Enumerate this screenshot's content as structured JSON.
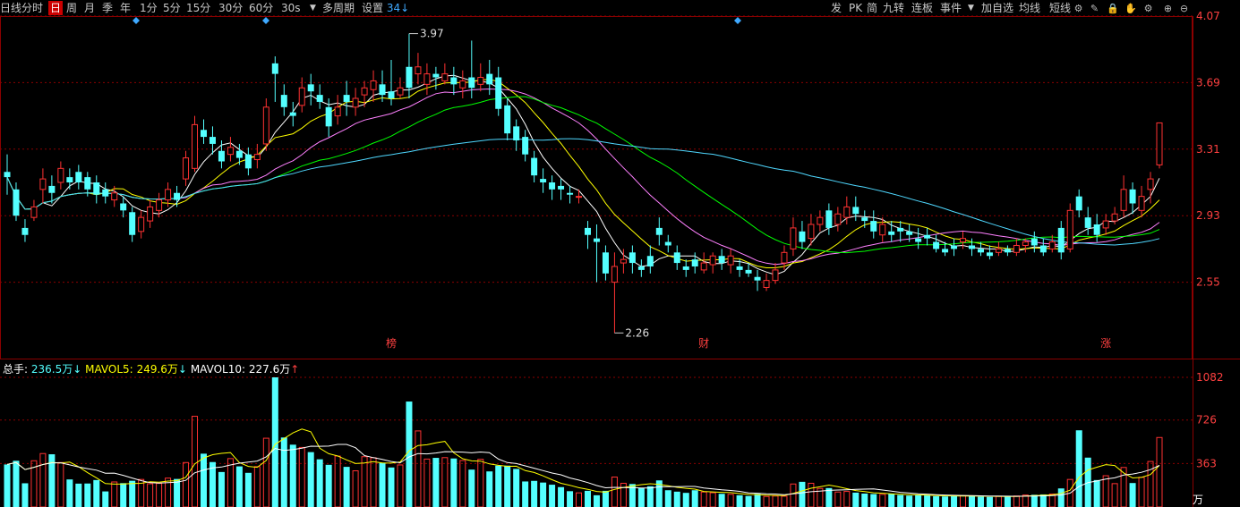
{
  "toolbar": {
    "left_items": [
      {
        "label": "日线",
        "active": false
      },
      {
        "label": "分时",
        "active": false
      },
      {
        "label": "日",
        "active": true
      },
      {
        "label": "周",
        "active": false
      },
      {
        "label": "月",
        "active": false
      },
      {
        "label": "季",
        "active": false
      },
      {
        "label": "年",
        "active": false
      },
      {
        "label": "1分",
        "active": false
      },
      {
        "label": "5分",
        "active": false
      },
      {
        "label": "15分",
        "active": false
      },
      {
        "label": "30分",
        "active": false
      },
      {
        "label": "60分",
        "active": false
      },
      {
        "label": "30s",
        "active": false
      },
      {
        "label": "多周期",
        "active": false
      }
    ],
    "settings_label": "设置",
    "settings_value": "34",
    "right_items": [
      "发",
      "PK",
      "简",
      "九转",
      "连板",
      "事件",
      "加自选",
      "均线",
      "短线"
    ],
    "icons": [
      "tool-icon",
      "pen-icon",
      "lock-icon",
      "hand-icon",
      "gear-icon",
      "zoom-in-icon",
      "zoom-out-icon"
    ]
  },
  "colors": {
    "up": "#ff3232",
    "down": "#54ffff",
    "ma5": "#ffffff",
    "ma10": "#ffff00",
    "ma20": "#ff80ff",
    "ma30": "#00ff00",
    "ma60": "#4fd8ff",
    "grid": "#8b0000",
    "axis_text": "#ff4040",
    "vol_ma5": "#ffff00",
    "vol_ma10": "#ffffff"
  },
  "chart_data": {
    "type": "candlestick",
    "price_axis": {
      "ticks": [
        "4.07",
        "3.69",
        "3.31",
        "2.93",
        "2.55"
      ],
      "ylim": [
        2.17,
        4.07
      ]
    },
    "volume_axis": {
      "ticks": [
        "1082",
        "726",
        "363"
      ],
      "unit": "万",
      "ylim": [
        0,
        1082
      ]
    },
    "annotations": {
      "high": "3.97",
      "low": "2.26"
    },
    "markers": [
      {
        "label": "榜",
        "index": 43
      },
      {
        "label": "财",
        "index": 78
      },
      {
        "label": "涨",
        "index": 123
      }
    ],
    "volume_legend": {
      "total_label": "总手:",
      "total_value": "236.5万",
      "total_arrow": "↓",
      "ma5_label": "MAVOL5:",
      "ma5_value": "249.6万",
      "ma5_arrow": "↓",
      "ma10_label": "MAVOL10:",
      "ma10_value": "227.6万",
      "ma10_arrow": "↑"
    },
    "candles": [
      [
        3.18,
        3.15,
        3.28,
        3.05,
        355
      ],
      [
        3.08,
        2.93,
        3.12,
        2.9,
        386
      ],
      [
        2.86,
        2.82,
        2.91,
        2.78,
        198
      ],
      [
        2.92,
        2.98,
        3.02,
        2.9,
        386
      ],
      [
        3.08,
        3.14,
        3.2,
        3.0,
        446
      ],
      [
        3.1,
        3.06,
        3.16,
        3.0,
        440
      ],
      [
        3.12,
        3.2,
        3.24,
        3.08,
        371
      ],
      [
        3.15,
        3.12,
        3.2,
        3.08,
        230
      ],
      [
        3.18,
        3.12,
        3.22,
        3.08,
        195
      ],
      [
        3.15,
        3.08,
        3.18,
        3.04,
        196
      ],
      [
        3.12,
        3.05,
        3.16,
        3.0,
        225
      ],
      [
        3.08,
        3.04,
        3.12,
        3.0,
        130
      ],
      [
        3.02,
        3.06,
        3.1,
        2.98,
        209
      ],
      [
        3.0,
        2.96,
        3.04,
        2.92,
        199
      ],
      [
        2.95,
        2.82,
        2.98,
        2.78,
        219
      ],
      [
        2.84,
        2.92,
        2.96,
        2.8,
        230
      ],
      [
        2.9,
        2.98,
        3.02,
        2.86,
        194
      ],
      [
        2.96,
        3.02,
        3.06,
        2.92,
        197
      ],
      [
        3.02,
        3.08,
        3.12,
        2.98,
        241
      ],
      [
        3.06,
        3.02,
        3.1,
        2.98,
        234
      ],
      [
        3.14,
        3.26,
        3.3,
        3.1,
        371
      ],
      [
        3.2,
        3.45,
        3.5,
        3.18,
        757
      ],
      [
        3.42,
        3.38,
        3.48,
        3.34,
        445
      ],
      [
        3.38,
        3.34,
        3.44,
        3.28,
        375
      ],
      [
        3.3,
        3.24,
        3.36,
        3.2,
        292
      ],
      [
        3.28,
        3.32,
        3.38,
        3.24,
        404
      ],
      [
        3.3,
        3.26,
        3.34,
        3.22,
        339
      ],
      [
        3.28,
        3.2,
        3.32,
        3.16,
        285
      ],
      [
        3.25,
        3.28,
        3.34,
        3.2,
        337
      ],
      [
        3.34,
        3.55,
        3.6,
        3.3,
        574
      ],
      [
        3.8,
        3.74,
        3.84,
        3.58,
        1082
      ],
      [
        3.62,
        3.55,
        3.68,
        3.5,
        580
      ],
      [
        3.52,
        3.5,
        3.58,
        3.44,
        520
      ],
      [
        3.56,
        3.66,
        3.72,
        3.52,
        497
      ],
      [
        3.68,
        3.64,
        3.74,
        3.56,
        458
      ],
      [
        3.62,
        3.58,
        3.68,
        3.54,
        398
      ],
      [
        3.55,
        3.44,
        3.6,
        3.38,
        352
      ],
      [
        3.5,
        3.55,
        3.62,
        3.45,
        425
      ],
      [
        3.62,
        3.58,
        3.7,
        3.5,
        335
      ],
      [
        3.55,
        3.6,
        3.66,
        3.5,
        302
      ],
      [
        3.62,
        3.66,
        3.7,
        3.55,
        420
      ],
      [
        3.65,
        3.7,
        3.76,
        3.58,
        411
      ],
      [
        3.68,
        3.62,
        3.76,
        3.58,
        370
      ],
      [
        3.64,
        3.6,
        3.82,
        3.56,
        330
      ],
      [
        3.62,
        3.66,
        3.72,
        3.6,
        351
      ],
      [
        3.78,
        3.66,
        3.97,
        3.6,
        880
      ],
      [
        3.74,
        3.78,
        3.86,
        3.68,
        635
      ],
      [
        3.68,
        3.74,
        3.8,
        3.62,
        400
      ],
      [
        3.74,
        3.72,
        3.78,
        3.65,
        410
      ],
      [
        3.7,
        3.74,
        3.8,
        3.68,
        412
      ],
      [
        3.72,
        3.68,
        3.78,
        3.62,
        405
      ],
      [
        3.66,
        3.7,
        3.76,
        3.6,
        388
      ],
      [
        3.72,
        3.66,
        3.93,
        3.6,
        312
      ],
      [
        3.68,
        3.72,
        3.8,
        3.64,
        398
      ],
      [
        3.74,
        3.68,
        3.82,
        3.62,
        297
      ],
      [
        3.72,
        3.54,
        3.78,
        3.5,
        345
      ],
      [
        3.56,
        3.4,
        3.6,
        3.36,
        345
      ],
      [
        3.44,
        3.36,
        3.48,
        3.3,
        318
      ],
      [
        3.38,
        3.28,
        3.42,
        3.24,
        213
      ],
      [
        3.26,
        3.16,
        3.3,
        3.12,
        218
      ],
      [
        3.14,
        3.12,
        3.2,
        3.06,
        204
      ],
      [
        3.12,
        3.08,
        3.16,
        3.02,
        186
      ],
      [
        3.1,
        3.08,
        3.14,
        3.02,
        166
      ],
      [
        3.06,
        3.05,
        3.1,
        3.0,
        132
      ],
      [
        3.04,
        3.04,
        3.08,
        3.0,
        118
      ],
      [
        2.86,
        2.82,
        2.9,
        2.74,
        135
      ],
      [
        2.8,
        2.78,
        2.88,
        2.55,
        98
      ],
      [
        2.72,
        2.6,
        2.76,
        2.56,
        135
      ],
      [
        2.55,
        2.64,
        2.72,
        2.26,
        250
      ],
      [
        2.66,
        2.68,
        2.74,
        2.6,
        198
      ],
      [
        2.72,
        2.66,
        2.76,
        2.6,
        192
      ],
      [
        2.64,
        2.62,
        2.68,
        2.58,
        157
      ],
      [
        2.7,
        2.64,
        2.76,
        2.6,
        173
      ],
      [
        2.86,
        2.82,
        2.92,
        2.76,
        222
      ],
      [
        2.78,
        2.76,
        2.82,
        2.72,
        140
      ],
      [
        2.72,
        2.66,
        2.76,
        2.62,
        128
      ],
      [
        2.64,
        2.62,
        2.68,
        2.58,
        118
      ],
      [
        2.68,
        2.64,
        2.72,
        2.6,
        140
      ],
      [
        2.62,
        2.66,
        2.72,
        2.6,
        125
      ],
      [
        2.65,
        2.7,
        2.72,
        2.6,
        119
      ],
      [
        2.7,
        2.66,
        2.74,
        2.62,
        110
      ],
      [
        2.65,
        2.7,
        2.74,
        2.6,
        106
      ],
      [
        2.64,
        2.62,
        2.68,
        2.58,
        98
      ],
      [
        2.62,
        2.6,
        2.66,
        2.58,
        92
      ],
      [
        2.58,
        2.56,
        2.62,
        2.5,
        110
      ],
      [
        2.52,
        2.56,
        2.6,
        2.5,
        88
      ],
      [
        2.56,
        2.62,
        2.66,
        2.54,
        92
      ],
      [
        2.66,
        2.72,
        2.76,
        2.62,
        90
      ],
      [
        2.74,
        2.86,
        2.92,
        2.7,
        192
      ],
      [
        2.84,
        2.78,
        2.9,
        2.74,
        210
      ],
      [
        2.8,
        2.88,
        2.94,
        2.76,
        198
      ],
      [
        2.88,
        2.92,
        2.96,
        2.84,
        155
      ],
      [
        2.96,
        2.86,
        3.0,
        2.82,
        158
      ],
      [
        2.88,
        2.94,
        2.98,
        2.84,
        125
      ],
      [
        2.92,
        2.98,
        3.04,
        2.88,
        130
      ],
      [
        2.98,
        2.94,
        3.04,
        2.9,
        120
      ],
      [
        2.92,
        2.9,
        2.96,
        2.86,
        112
      ],
      [
        2.9,
        2.84,
        2.96,
        2.8,
        108
      ],
      [
        2.82,
        2.88,
        2.92,
        2.78,
        105
      ],
      [
        2.84,
        2.82,
        2.9,
        2.78,
        108
      ],
      [
        2.86,
        2.84,
        2.9,
        2.78,
        100
      ],
      [
        2.84,
        2.82,
        2.88,
        2.78,
        95
      ],
      [
        2.8,
        2.78,
        2.86,
        2.74,
        98
      ],
      [
        2.82,
        2.8,
        2.86,
        2.76,
        97
      ],
      [
        2.78,
        2.74,
        2.82,
        2.72,
        90
      ],
      [
        2.74,
        2.72,
        2.78,
        2.7,
        88
      ],
      [
        2.76,
        2.74,
        2.8,
        2.7,
        90
      ],
      [
        2.78,
        2.8,
        2.84,
        2.74,
        95
      ],
      [
        2.76,
        2.74,
        2.8,
        2.7,
        92
      ],
      [
        2.74,
        2.72,
        2.78,
        2.7,
        86
      ],
      [
        2.72,
        2.7,
        2.76,
        2.68,
        84
      ],
      [
        2.72,
        2.74,
        2.78,
        2.7,
        88
      ],
      [
        2.74,
        2.72,
        2.76,
        2.7,
        90
      ],
      [
        2.72,
        2.76,
        2.8,
        2.7,
        92
      ],
      [
        2.76,
        2.78,
        2.8,
        2.72,
        100
      ],
      [
        2.8,
        2.76,
        2.84,
        2.72,
        102
      ],
      [
        2.76,
        2.72,
        2.8,
        2.7,
        105
      ],
      [
        2.74,
        2.78,
        2.82,
        2.72,
        108
      ],
      [
        2.86,
        2.72,
        2.9,
        2.68,
        155
      ],
      [
        2.74,
        2.96,
        3.0,
        2.72,
        230
      ],
      [
        3.04,
        2.96,
        3.08,
        2.92,
        640
      ],
      [
        2.92,
        2.86,
        2.98,
        2.82,
        412
      ],
      [
        2.88,
        2.82,
        2.94,
        2.78,
        225
      ],
      [
        2.86,
        2.9,
        2.94,
        2.82,
        261
      ],
      [
        2.9,
        2.94,
        2.98,
        2.88,
        195
      ],
      [
        2.96,
        3.08,
        3.16,
        2.92,
        330
      ],
      [
        3.08,
        3.0,
        3.12,
        2.94,
        200
      ],
      [
        2.96,
        3.04,
        3.1,
        2.92,
        248
      ],
      [
        3.08,
        3.14,
        3.18,
        3.0,
        380
      ],
      [
        3.22,
        3.46,
        3.46,
        3.2,
        580
      ]
    ]
  }
}
